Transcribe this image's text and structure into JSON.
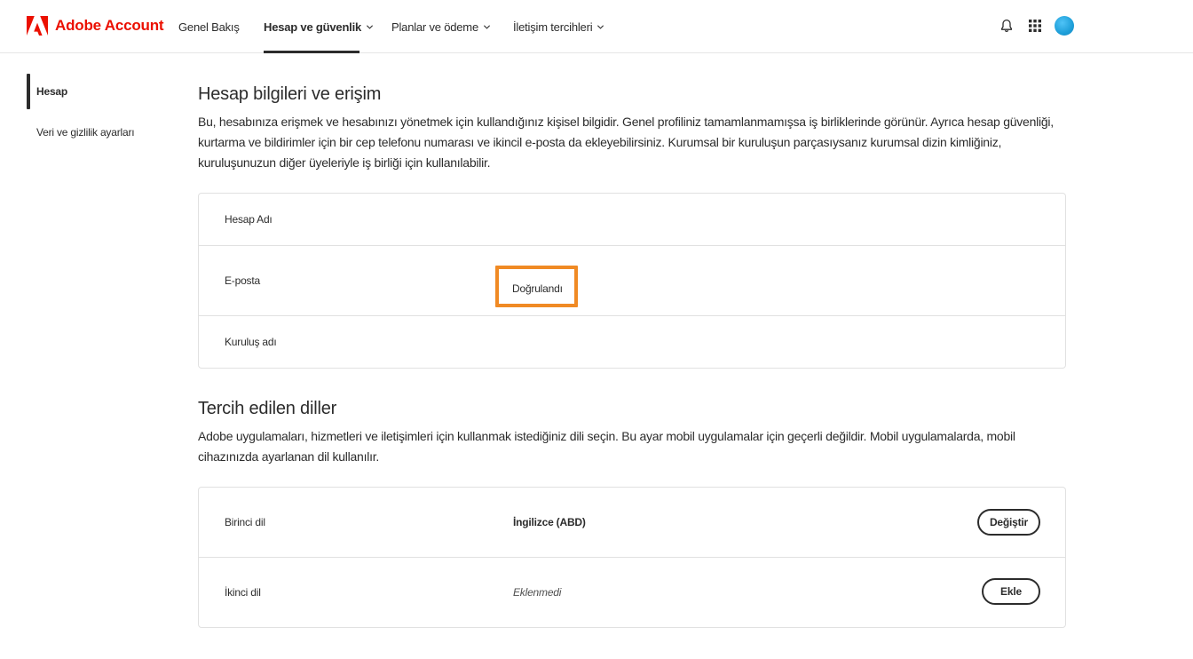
{
  "brand": {
    "name": "Adobe Account",
    "color": "#eb1000"
  },
  "nav": {
    "items": [
      {
        "label": "Genel Bakış",
        "has_dropdown": false
      },
      {
        "label": "Hesap ve güvenlik",
        "has_dropdown": true,
        "active": true
      },
      {
        "label": "Planlar ve ödeme",
        "has_dropdown": true
      },
      {
        "label": "İletişim tercihleri",
        "has_dropdown": true
      }
    ],
    "icons": [
      "bell-icon",
      "apps-grid-icon",
      "avatar"
    ]
  },
  "sidebar": {
    "items": [
      {
        "label": "Hesap",
        "active": true
      },
      {
        "label": "Veri ve gizlilik ayarları",
        "active": false
      }
    ]
  },
  "account_section": {
    "title": "Hesap bilgileri ve erişim",
    "description": "Bu, hesabınıza erişmek ve hesabınızı yönetmek için kullandığınız kişisel bilgidir. Genel profiliniz tamamlanmamışsa iş birliklerinde görünür. Ayrıca hesap güvenliği, kurtarma ve bildirimler için bir cep telefonu numarası ve ikincil e-posta da ekleyebilirsiniz. Kurumsal bir kuruluşun parçasıysanız kurumsal dizin kimliğiniz, kuruluşunuzun diğer üyeleriyle iş birliği için kullanılabilir.",
    "rows": [
      {
        "label": "Hesap Adı",
        "value": ""
      },
      {
        "label": "E-posta",
        "value": "Doğrulandı"
      },
      {
        "label": "Kuruluş adı",
        "value": ""
      }
    ],
    "highlight_color": "#f08a24"
  },
  "language_section": {
    "title": "Tercih edilen diller",
    "description": "Adobe uygulamaları, hizmetleri ve iletişimleri için kullanmak istediğiniz dili seçin. Bu ayar mobil uygulamalar için geçerli değildir. Mobil uygulamalarda, mobil cihazınızda ayarlanan dil kullanılır.",
    "rows": [
      {
        "label": "Birinci dil",
        "value": "İngilizce (ABD)",
        "button": "Değiştir"
      },
      {
        "label": "İkinci dil",
        "value": "Eklenmedi",
        "button": "Ekle"
      }
    ]
  }
}
